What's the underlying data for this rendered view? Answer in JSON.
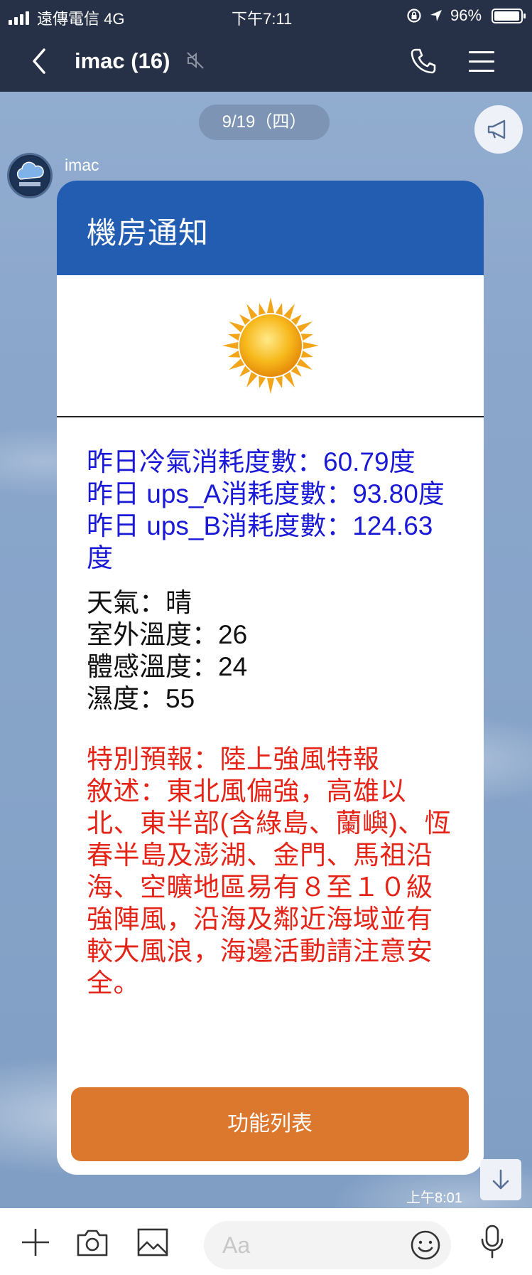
{
  "status_bar": {
    "carrier": "遠傳電信 4G",
    "time": "下午7:11",
    "battery": "96%",
    "battery_level": 0.96
  },
  "header": {
    "title": "imac (16)",
    "icons": [
      "back-icon",
      "mute-icon",
      "phone-icon",
      "menu-icon"
    ]
  },
  "chat": {
    "date": "9/19（四）",
    "sender": "imac",
    "timestamp": "上午8:01"
  },
  "card": {
    "title": "機房通知",
    "hero_icon": "sun-icon",
    "energy": [
      "昨日冷氣消耗度數：60.79度",
      "昨日 ups_A消耗度數：93.80度",
      "昨日 ups_B消耗度數：124.63度"
    ],
    "weather": [
      "天氣：晴",
      "室外溫度：26",
      "體感溫度：24",
      "濕度：55"
    ],
    "alert": "特別預報：陸上強風特報\n敘述：東北風偏強，高雄以北、東半部(含綠島、蘭嶼)、恆春半島及澎湖、金門、馬祖沿海、空曠地區易有８至１０級強陣風，沿海及鄰近海域並有較大風浪，海邊活動請注意安全。",
    "button_label": "功能列表"
  },
  "input_bar": {
    "placeholder": "Aa",
    "icons": [
      "plus-icon",
      "camera-icon",
      "image-icon",
      "emoji-icon",
      "microphone-icon"
    ]
  },
  "colors": {
    "header_bg": "#263046",
    "card_head": "#225db2",
    "energy_text": "#1a19d6",
    "alert_text": "#e52418",
    "button": "#dc782d"
  }
}
